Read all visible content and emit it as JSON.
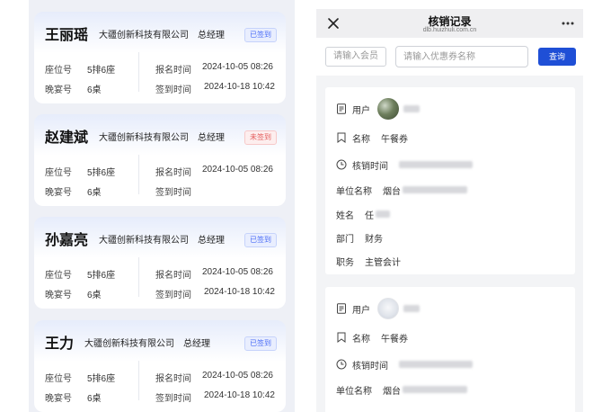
{
  "attendees": [
    {
      "name": "王丽瑶",
      "company": "大疆创新科技有限公司",
      "title": "总经理",
      "status": "已签到",
      "status_type": "signed",
      "seat_label": "座位号",
      "seat": "5排6座",
      "table_label": "晚宴号",
      "table": "6桌",
      "reg_label": "报名时间",
      "reg_time": "2024-10-05   08:26",
      "sign_label": "签到时间",
      "sign_time": "2024-10-18   10:42"
    },
    {
      "name": "赵建斌",
      "company": "大疆创新科技有限公司",
      "title": "总经理",
      "status": "未签到",
      "status_type": "unsigned",
      "seat_label": "座位号",
      "seat": "5排6座",
      "table_label": "晚宴号",
      "table": "6桌",
      "reg_label": "报名时间",
      "reg_time": "2024-10-05   08:26",
      "sign_label": "签到时间",
      "sign_time": ""
    },
    {
      "name": "孙嘉亮",
      "company": "大疆创新科技有限公司",
      "title": "总经理",
      "status": "已签到",
      "status_type": "signed",
      "seat_label": "座位号",
      "seat": "5排6座",
      "table_label": "晚宴号",
      "table": "6桌",
      "reg_label": "报名时间",
      "reg_time": "2024-10-05   08:26",
      "sign_label": "签到时间",
      "sign_time": "2024-10-18   10:42"
    },
    {
      "name": "王力",
      "company": "大疆创新科技有限公司",
      "title": "总经理",
      "status": "已签到",
      "status_type": "signed",
      "seat_label": "座位号",
      "seat": "5排6座",
      "table_label": "晚宴号",
      "table": "6桌",
      "reg_label": "报名时间",
      "reg_time": "2024-10-05   08:26",
      "sign_label": "签到时间",
      "sign_time": "2024-10-18   10:42"
    }
  ],
  "records_page": {
    "title": "核销记录",
    "subtitle": "dlb.huizhuli.com.cn",
    "member_placeholder": "请输入会员",
    "coupon_placeholder": "请输入优惠券名称",
    "query_label": "查询",
    "records": [
      {
        "user_label": "用户",
        "name_label": "名称",
        "name_value": "午餐券",
        "time_label": "核销时间",
        "unit_label": "单位名称",
        "unit_prefix": "烟台",
        "person_label": "姓名",
        "person_prefix": "任",
        "dept_label": "部门",
        "dept_value": "财务",
        "position_label": "职务",
        "position_value": "主管会计"
      },
      {
        "user_label": "用户",
        "name_label": "名称",
        "name_value": "午餐券",
        "time_label": "核销时间",
        "unit_label": "单位名称",
        "unit_prefix": "烟台"
      }
    ]
  },
  "colors": {
    "accent": "#1f4fd6",
    "signed": "#4a6cf7",
    "unsigned": "#e45a5a"
  }
}
